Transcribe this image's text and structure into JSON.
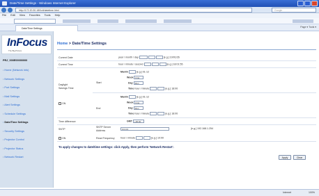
{
  "browser": {
    "title": "Date/Time Settings - Windows Internet Explorer",
    "address": "http://172.20.30.180/ctl/datetime.html",
    "search_placeholder": "Google",
    "menu": [
      "File",
      "Edit",
      "View",
      "Favorites",
      "Tools",
      "Help"
    ],
    "tab_label": "Date/Time Settings",
    "tab_tools": "Page ▾  Tools ▾",
    "status_zone": "Internet",
    "status_zoom": "100%"
  },
  "sidebar": {
    "brand": "InFocus",
    "tagline": "The Big Picture",
    "hostname": "PRJ_000E00000000",
    "items": [
      {
        "label": "Home (Network Info)",
        "active": false
      },
      {
        "label": "Network Settings",
        "active": false
      },
      {
        "label": "Port Settings",
        "active": false
      },
      {
        "label": "Mail Settings",
        "active": false
      },
      {
        "label": "Alert Settings",
        "active": false
      },
      {
        "label": "Schedule Settings",
        "active": false
      },
      {
        "label": "Date/Time Settings",
        "active": true
      },
      {
        "label": "Security Settings",
        "active": false
      },
      {
        "label": "Projector Control",
        "active": false
      },
      {
        "label": "Projector Status",
        "active": false
      },
      {
        "label": "Network Restart",
        "active": false
      }
    ]
  },
  "content": {
    "breadcrumb_home": "Home",
    "breadcrumb_sep": " > ",
    "page_title": "Date/Time Settings",
    "current_date_label": "Current Date",
    "current_date_fmt": "year / month / day",
    "current_date_hint": "[e.g.] 10/01/26",
    "current_time_label": "Current Time",
    "current_time_fmt": "hour / minute / second",
    "current_time_hint": "[e.g.] 18:01:55",
    "dst_label": "Daylight Savings Time",
    "on_label": "ON",
    "start_label": "Start",
    "end_label": "End",
    "month_label": "Month",
    "month_hint": "[e.g.] 01-12",
    "week_label": "Week",
    "week_value": "First",
    "day_label": "Day",
    "day_value": "Mon",
    "time_label": "Time",
    "time_fmt": "hour / minute",
    "time_hint": "[e.g.] 18:00",
    "time_diff_label": "Time difference",
    "gmt_label": "GMT",
    "gmt_value": "+00:00",
    "sntp_label": "SNTP",
    "sntp_server_label": "SNTP Server Address",
    "sntp_server_value": "0.0.0.0",
    "sntp_hint": "[e.g.] 192.168.1.254",
    "read_freq_label": "Read Frequency",
    "read_freq_fmt": "hour / minute",
    "read_freq_hint": "[e.g.] 10:00",
    "apply_note": "To apply changes to date/time settings: click Apply, then perform 'Network Restart'.",
    "apply_button": "Apply",
    "clear_button": "Clear"
  }
}
